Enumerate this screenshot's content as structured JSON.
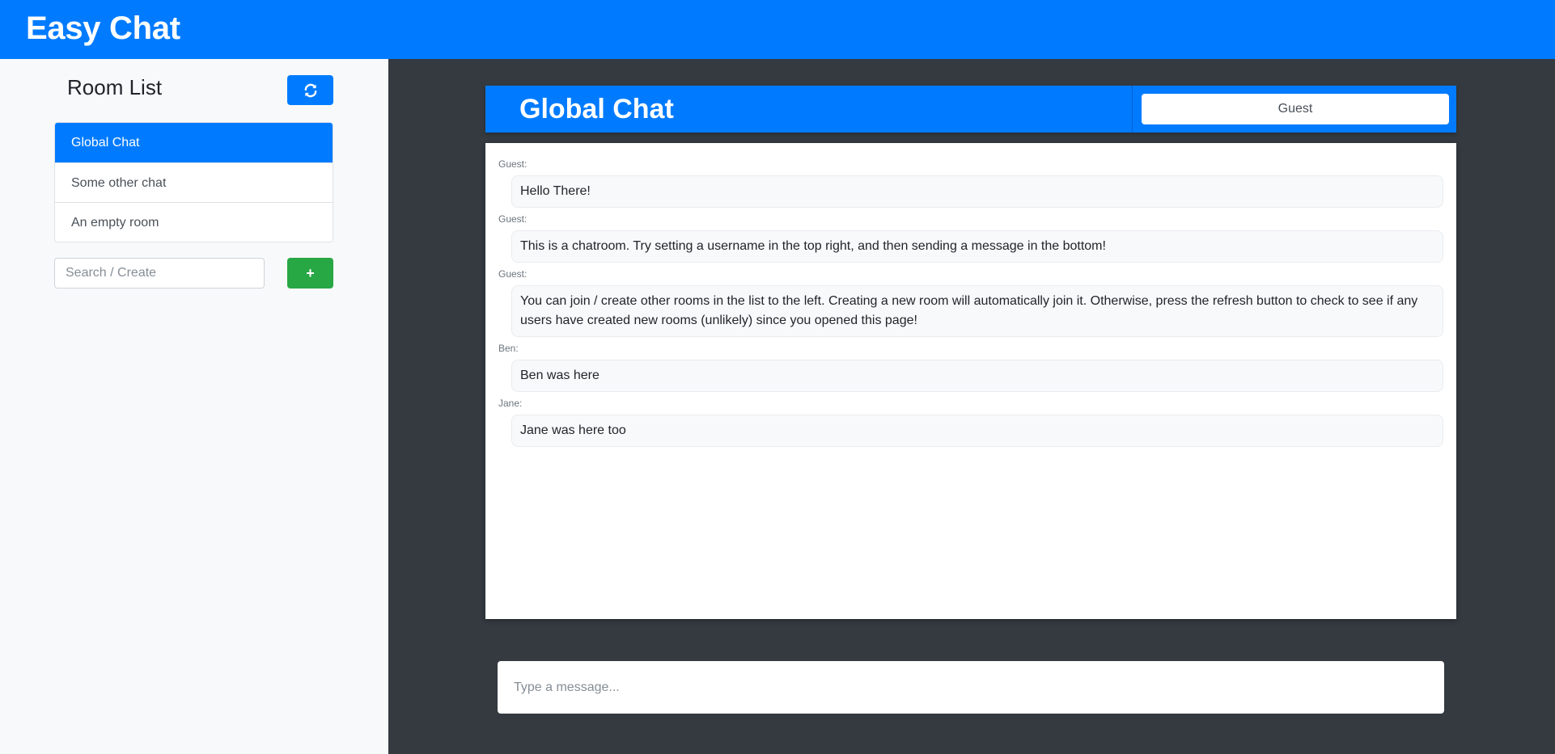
{
  "app": {
    "title": "Easy Chat"
  },
  "sidebar": {
    "title": "Room List",
    "refresh_icon": "refresh-icon",
    "rooms": [
      {
        "label": "Global Chat",
        "active": true
      },
      {
        "label": "Some other chat",
        "active": false
      },
      {
        "label": "An empty room",
        "active": false
      }
    ],
    "search": {
      "placeholder": "Search / Create",
      "value": ""
    },
    "add_label": "+"
  },
  "chat": {
    "title": "Global Chat",
    "username": "Guest",
    "messages": [
      {
        "user": "Guest:",
        "text": "Hello There!"
      },
      {
        "user": "Guest:",
        "text": "This is a chatroom. Try setting a username in the top right, and then sending a message in the bottom!"
      },
      {
        "user": "Guest:",
        "text": "You can join / create other rooms in the list to the left. Creating a new room will automatically join it. Otherwise, press the refresh button to check to see if any users have created new rooms (unlikely) since you opened this page!"
      },
      {
        "user": "Ben:",
        "text": "Ben was here"
      },
      {
        "user": "Jane:",
        "text": "Jane was here too"
      }
    ],
    "composer": {
      "placeholder": "Type a message...",
      "value": ""
    }
  },
  "colors": {
    "primary": "#007bff",
    "success": "#28a745",
    "dark": "#343a40",
    "light": "#f8f9fa"
  }
}
